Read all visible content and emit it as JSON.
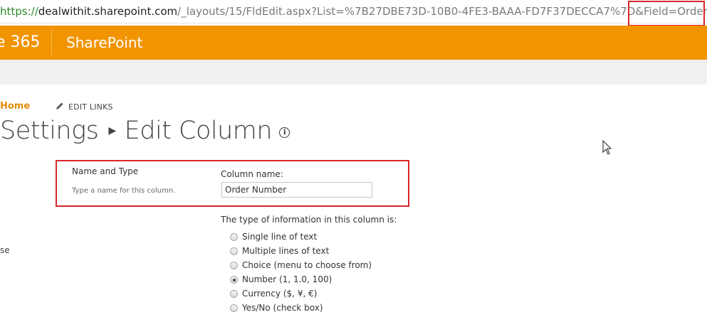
{
  "browser": {
    "url_protocol": "https://",
    "url_domain": "dealwithit.sharepoint.com",
    "url_path": "/_layouts/15/FldEdit.aspx?List=%7B27DBE73D-10B0-4FE3-BAAA-FD7F37DECCA7%7D&Field=",
    "url_field_value": "OrderNumber"
  },
  "suite_bar": {
    "brand": "e 365",
    "app_name": "SharePoint",
    "color": "#f29400"
  },
  "nav": {
    "home": "Home",
    "edit_links": "EDIT LINKS"
  },
  "page": {
    "title_part1": "Settings",
    "title_part2": "Edit Column",
    "info_glyph": "i"
  },
  "section": {
    "title": "Name and Type",
    "description": "Type a name for this column.",
    "column_name_label": "Column name:",
    "column_name_value": "Order Number"
  },
  "left_fragment": "se",
  "type": {
    "label": "The type of information in this column is:",
    "options": [
      {
        "label": "Single line of text",
        "checked": false
      },
      {
        "label": "Multiple lines of text",
        "checked": false
      },
      {
        "label": "Choice (menu to choose from)",
        "checked": false
      },
      {
        "label": "Number (1, 1.0, 100)",
        "checked": true
      },
      {
        "label": "Currency ($, ¥, €)",
        "checked": false
      },
      {
        "label": "Yes/No (check box)",
        "checked": false
      }
    ]
  },
  "highlight_color": "#d8262d"
}
